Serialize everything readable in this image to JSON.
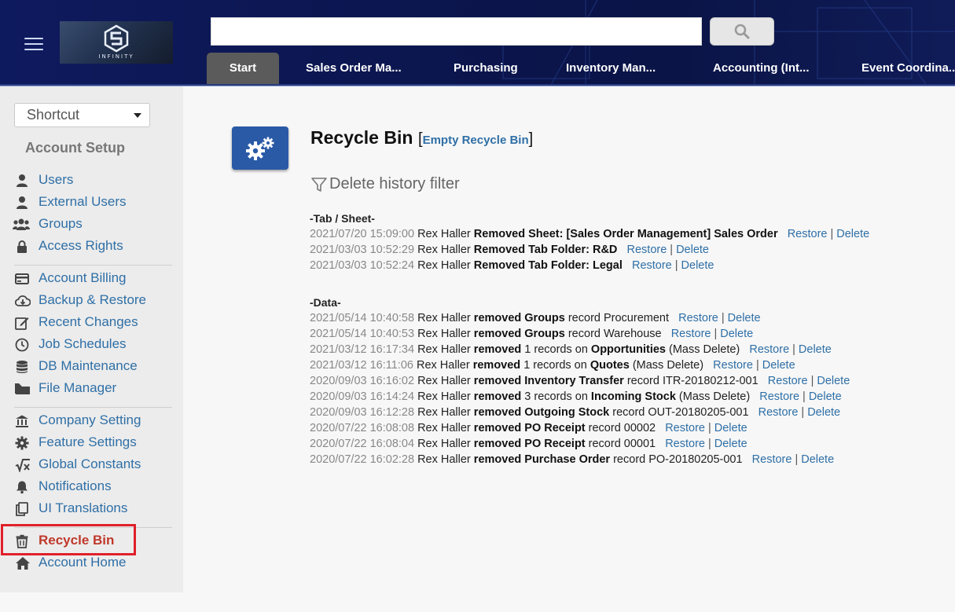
{
  "header": {
    "logo_text": "INFINITY",
    "search": {
      "value": "",
      "placeholder": ""
    },
    "tabs": [
      {
        "label": "Start"
      },
      {
        "label": "Sales Order Ma..."
      },
      {
        "label": "Purchasing"
      },
      {
        "label": "Inventory Man..."
      },
      {
        "label": "Accounting (Int..."
      },
      {
        "label": "Event Coordina..."
      }
    ]
  },
  "sidebar": {
    "shortcut_label": "Shortcut",
    "section_title": "Account Setup",
    "items": [
      {
        "label": "Users",
        "icon": "user-icon"
      },
      {
        "label": "External Users",
        "icon": "user-icon"
      },
      {
        "label": "Groups",
        "icon": "users-icon"
      },
      {
        "label": "Access Rights",
        "icon": "lock-icon"
      },
      {
        "label": "Account Billing",
        "icon": "credit-card-icon"
      },
      {
        "label": "Backup & Restore",
        "icon": "cloud-download-icon"
      },
      {
        "label": "Recent Changes",
        "icon": "edit-icon"
      },
      {
        "label": "Job Schedules",
        "icon": "clock-icon"
      },
      {
        "label": "DB Maintenance",
        "icon": "database-icon"
      },
      {
        "label": "File Manager",
        "icon": "folder-icon"
      },
      {
        "label": "Company Setting",
        "icon": "bank-icon"
      },
      {
        "label": "Feature Settings",
        "icon": "gear-icon"
      },
      {
        "label": "Global Constants",
        "icon": "square-root-icon"
      },
      {
        "label": "Notifications",
        "icon": "bell-icon"
      },
      {
        "label": "UI Translations",
        "icon": "copy-icon"
      },
      {
        "label": "Recycle Bin",
        "icon": "trash-icon",
        "active": true
      },
      {
        "label": "Account Home",
        "icon": "home-icon"
      }
    ]
  },
  "main": {
    "title": "Recycle Bin",
    "empty_bin_link": "Empty Recycle Bin",
    "filter_label": "Delete history filter",
    "restore_label": "Restore",
    "delete_label": "Delete",
    "tab_sheet_heading": "-Tab / Sheet-",
    "tab_sheet_entries": [
      {
        "ts": "2021/07/20 15:09:00",
        "user": "Rex Haller",
        "bold": "Removed Sheet: [Sales Order Management] Sales Order",
        "rest": ""
      },
      {
        "ts": "2021/03/03 10:52:29",
        "user": "Rex Haller",
        "bold": "Removed Tab Folder: R&D",
        "rest": ""
      },
      {
        "ts": "2021/03/03 10:52:24",
        "user": "Rex Haller",
        "bold": "Removed Tab Folder: Legal",
        "rest": ""
      }
    ],
    "data_heading": "-Data-",
    "data_entries": [
      {
        "ts": "2021/05/14 10:40:58",
        "user": "Rex Haller",
        "parts": [
          [
            "b",
            "removed Groups"
          ],
          [
            "t",
            " record Procurement"
          ]
        ]
      },
      {
        "ts": "2021/05/14 10:40:53",
        "user": "Rex Haller",
        "parts": [
          [
            "b",
            "removed Groups"
          ],
          [
            "t",
            " record Warehouse"
          ]
        ]
      },
      {
        "ts": "2021/03/12 16:17:34",
        "user": "Rex Haller",
        "parts": [
          [
            "b",
            "removed"
          ],
          [
            "t",
            " 1 records on "
          ],
          [
            "b",
            "Opportunities"
          ],
          [
            "t",
            " (Mass Delete)"
          ]
        ]
      },
      {
        "ts": "2021/03/12 16:11:06",
        "user": "Rex Haller",
        "parts": [
          [
            "b",
            "removed"
          ],
          [
            "t",
            " 1 records on "
          ],
          [
            "b",
            "Quotes"
          ],
          [
            "t",
            " (Mass Delete)"
          ]
        ]
      },
      {
        "ts": "2020/09/03 16:16:02",
        "user": "Rex Haller",
        "parts": [
          [
            "b",
            "removed Inventory Transfer"
          ],
          [
            "t",
            " record ITR-20180212-001"
          ]
        ]
      },
      {
        "ts": "2020/09/03 16:14:24",
        "user": "Rex Haller",
        "parts": [
          [
            "b",
            "removed"
          ],
          [
            "t",
            " 3 records on "
          ],
          [
            "b",
            "Incoming Stock"
          ],
          [
            "t",
            " (Mass Delete)"
          ]
        ]
      },
      {
        "ts": "2020/09/03 16:12:28",
        "user": "Rex Haller",
        "parts": [
          [
            "b",
            "removed Outgoing Stock"
          ],
          [
            "t",
            " record OUT-20180205-001"
          ]
        ]
      },
      {
        "ts": "2020/07/22 16:08:08",
        "user": "Rex Haller",
        "parts": [
          [
            "b",
            "removed PO Receipt"
          ],
          [
            "t",
            " record 00002"
          ]
        ]
      },
      {
        "ts": "2020/07/22 16:08:04",
        "user": "Rex Haller",
        "parts": [
          [
            "b",
            "removed PO Receipt"
          ],
          [
            "t",
            " record 00001"
          ]
        ]
      },
      {
        "ts": "2020/07/22 16:02:28",
        "user": "Rex Haller",
        "parts": [
          [
            "b",
            "removed Purchase Order"
          ],
          [
            "t",
            " record PO-20180205-001"
          ]
        ]
      }
    ]
  },
  "colors": {
    "link": "#2f6fa6",
    "active": "#c0392b",
    "highlight": "#e0202a",
    "header": "#0e1a5e",
    "icon_bg": "#2a5aa6"
  }
}
